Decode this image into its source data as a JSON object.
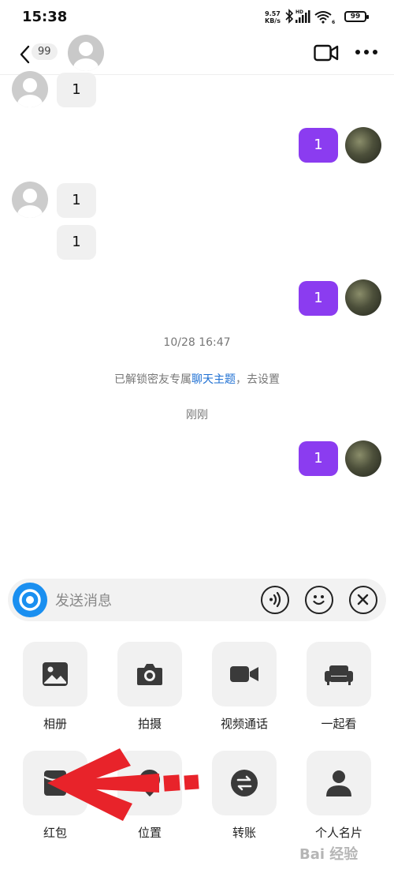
{
  "status_bar": {
    "time": "15:38",
    "net_speed_value": "9.57",
    "net_speed_unit": "KB/s",
    "hd_label": "HD",
    "wifi_label": "6",
    "battery": "99"
  },
  "header": {
    "unread_count": "99",
    "icons": [
      "back-icon",
      "video-call-icon",
      "more-icon"
    ]
  },
  "messages": [
    {
      "side": "in",
      "text": "1"
    },
    {
      "side": "out",
      "text": "1"
    },
    {
      "side": "in",
      "text": "1"
    },
    {
      "side": "in",
      "text": "1"
    },
    {
      "side": "out",
      "text": "1"
    },
    {
      "side": "out",
      "text": "1"
    }
  ],
  "system": {
    "timestamp": "10/28 16:47",
    "unlock_prefix": "已解锁密友专属",
    "unlock_link": "聊天主题",
    "unlock_suffix": "，去设置",
    "just_now": "刚刚"
  },
  "input": {
    "placeholder": "发送消息"
  },
  "panel_items": [
    {
      "label": "相册",
      "icon": "photo-album-icon"
    },
    {
      "label": "拍摄",
      "icon": "camera-icon"
    },
    {
      "label": "视频通话",
      "icon": "video-call-icon"
    },
    {
      "label": "一起看",
      "icon": "sofa-icon"
    },
    {
      "label": "红包",
      "icon": "red-packet-icon"
    },
    {
      "label": "位置",
      "icon": "location-icon"
    },
    {
      "label": "转账",
      "icon": "transfer-icon"
    },
    {
      "label": "个人名片",
      "icon": "contact-card-icon"
    }
  ],
  "watermark": "Bai 经验",
  "colors": {
    "outgoing_bubble": "#8b3cf0",
    "incoming_bubble": "#f0f0f0",
    "link": "#1d6fd3",
    "camera_button": "#1a8ff0",
    "annotation_arrow": "#e8232a"
  }
}
